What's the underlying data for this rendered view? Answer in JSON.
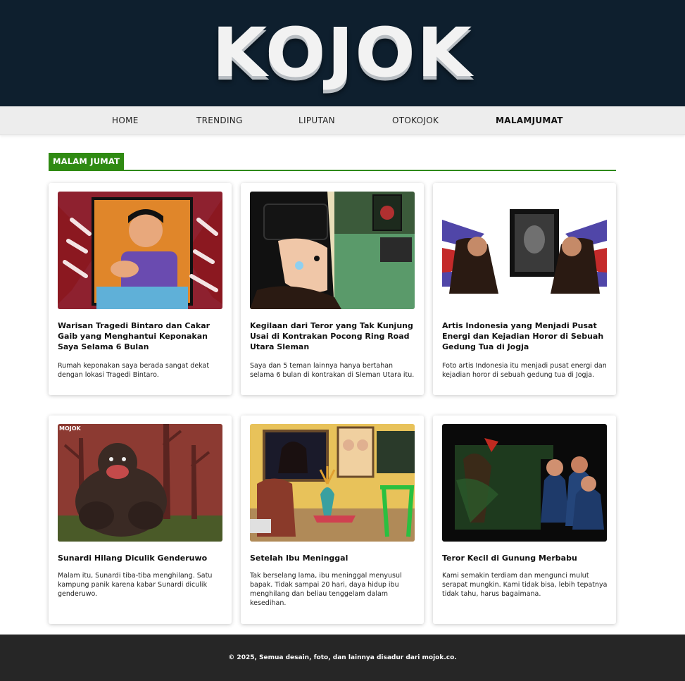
{
  "site": {
    "logo": "KOJOK"
  },
  "nav": [
    {
      "label": "HOME",
      "active": false
    },
    {
      "label": "TRENDING",
      "active": false
    },
    {
      "label": "LIPUTAN",
      "active": false
    },
    {
      "label": "OTOKOJOK",
      "active": false
    },
    {
      "label": "MALAMJUMAT",
      "active": true
    }
  ],
  "section": {
    "title": "MALAM JUMAT",
    "accent_color": "#2f8a12"
  },
  "articles": [
    {
      "title": "Warisan Tragedi Bintaro dan Cakar Gaib yang Menghantui Keponakan Saya Selama 6 Bulan",
      "excerpt": "Rumah keponakan saya berada sangat dekat dengan lokasi Tragedi Bintaro."
    },
    {
      "title": "Kegilaan dari Teror yang Tak Kunjung Usai di Kontrakan Pocong Ring Road Utara Sleman",
      "excerpt": "Saya dan 5 teman lainnya hanya bertahan selama 6 bulan di kontrakan di Sleman Utara itu."
    },
    {
      "title": "Artis Indonesia yang Menjadi Pusat Energi dan Kejadian Horor di Sebuah Gedung Tua di Jogja",
      "excerpt": "Foto artis Indonesia itu menjadi pusat energi dan kejadian horor di sebuah gedung tua di Jogja."
    },
    {
      "title": "Sunardi Hilang Diculik Genderuwo",
      "excerpt": "Malam itu, Sunardi tiba-tiba menghilang. Satu kampung panik karena kabar Sunardi diculik genderuwo.",
      "thumb_label": "MOJOK"
    },
    {
      "title": "Setelah Ibu Meninggal",
      "excerpt": "Tak berselang lama, ibu meninggal menyusul bapak. Tidak sampai 20 hari, daya hidup ibu menghilang dan beliau tenggelam dalam kesedihan."
    },
    {
      "title": "Teror Kecil di Gunung Merbabu",
      "excerpt": "Kami semakin terdiam dan mengunci mulut serapat mungkin. Kami tidak bisa, lebih tepatnya tidak tahu, harus bagaimana."
    }
  ],
  "footer": {
    "text": "© 2025, Semua desain, foto, dan lainnya disadur dari mojok.co."
  },
  "colors": {
    "header_bg": "#0e1f2e",
    "nav_bg": "#ededed",
    "footer_bg": "#262626"
  }
}
